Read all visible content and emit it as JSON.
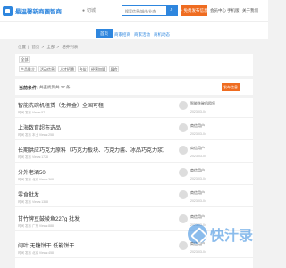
{
  "header": {
    "site_name": "最温馨新商圈智商",
    "city": "切城",
    "search_placeholder": "搜索信息/城市/业态",
    "search_icon": "search-icon",
    "publish_label": "+ 免费发布信息",
    "links": [
      "会员中心",
      "手机版",
      "关于我们"
    ]
  },
  "nav": {
    "items": [
      "首页",
      "商家招商",
      "商家活动",
      "商机动态"
    ]
  },
  "breadcrumb": [
    "位置",
    "首页",
    "全部",
    "培养列表"
  ],
  "filters": {
    "row1": [
      "全部"
    ],
    "row2": [
      "产品推介",
      "活动信息",
      "人才招聘",
      "合伙",
      "经营加盟",
      "展会"
    ]
  },
  "summary": {
    "label": "当前条件：",
    "text": "共查找到共 27 条",
    "subscribe_label": "发布信息"
  },
  "listings": [
    {
      "title": "智能洗碗机租赁（免押金）全国可租",
      "meta": "时间 发布 Views:57",
      "user": "智能洗碗机租赁",
      "date": "2023-03-04"
    },
    {
      "title": "上海数育超市选品",
      "meta": "时间 发布 本土 Views:258",
      "user": "商信用户",
      "date": "2023-03-04"
    },
    {
      "title": "长期供应巧克力原料（巧克力板块、巧克力酱、冰品巧克力浆）",
      "meta": "时间 发布 Views:1728",
      "user": "商信用户",
      "date": "2023-03-04"
    },
    {
      "title": "分外老酒50",
      "meta": "时间 发布 北京 Views:368",
      "user": "商信用户",
      "date": "2023-03-04"
    },
    {
      "title": "零食批发",
      "meta": "时间 发布 Views:1388",
      "user": "商信用户",
      "date": "2023-03-04"
    },
    {
      "title": "甘竹牌豆鼓鲮鱼227g 批发",
      "meta": "时间 发布 广东 Views:888",
      "user": "商信用户",
      "date": "2023-03-04"
    },
    {
      "title": "阔叶 无糖饼干 低能饼干",
      "meta": "时间 发布 北京 Views:458",
      "user": "商信用户",
      "date": "2023-03-04"
    }
  ],
  "watermark": {
    "text": "快汁录"
  }
}
